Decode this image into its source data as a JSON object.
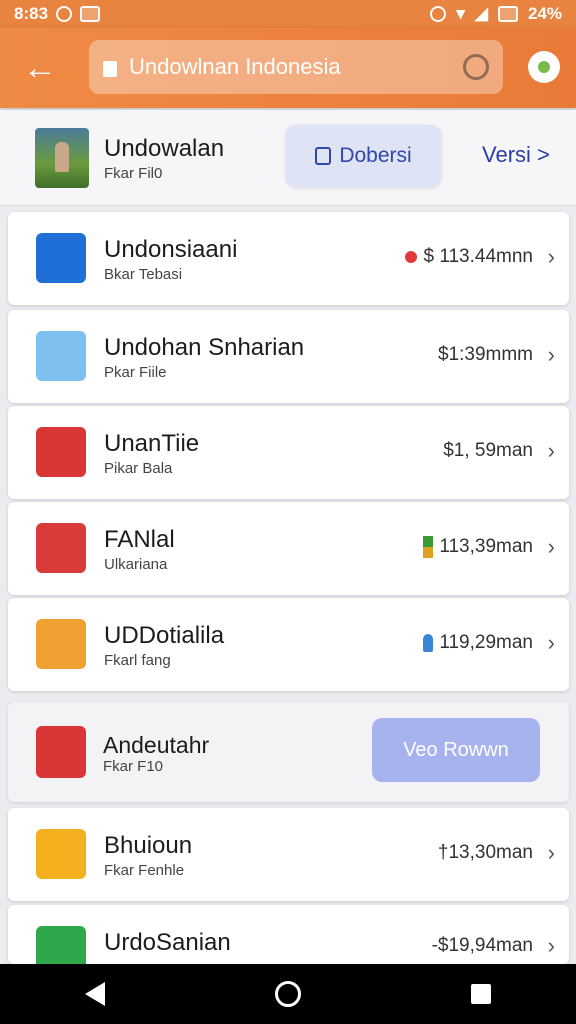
{
  "status_bar": {
    "time": "8:83",
    "battery": "24%"
  },
  "search": {
    "text": "Undowlnan Indonesia"
  },
  "featured": {
    "title": "Undowalan",
    "subtitle": "Fkar Fil0",
    "button_label": "Dobersi",
    "link_label": "Versi >"
  },
  "items": [
    {
      "name": "Undonsiaani",
      "sub": "Bkar Tebasi",
      "price": "$ 113.44mnn",
      "accent": "#e23a3a",
      "icon_color": "#1f6fd6",
      "icon_name": "app-icon-blue"
    },
    {
      "name": "Undohan Snharian",
      "sub": "Pkar Fiile",
      "price": "$1:39mmm",
      "accent": "",
      "icon_color": "#7ec0f0",
      "icon_name": "brush-icon"
    },
    {
      "name": "UnanTiie",
      "sub": "Pikar Bala",
      "price": "$1, 59man",
      "accent": "",
      "icon_color": "#d83535",
      "icon_name": "file-edit-icon"
    },
    {
      "name": "FANlal",
      "sub": "Ulkariana",
      "price": "113,39man",
      "accent": "bar",
      "icon_color": "#d93a3a",
      "icon_name": "document-icon"
    },
    {
      "name": "UDDotialila",
      "sub": "Fkarl fang",
      "price": "119,29man",
      "accent": "pin",
      "icon_color": "#f0a030",
      "icon_name": "folder-icon"
    }
  ],
  "featured2": {
    "name": "Andeutahr",
    "sub": "Fkar F10",
    "button_label": "Veo Rowwn"
  },
  "items2": [
    {
      "name": "Bhuioun",
      "sub": "Fkar Fenhle",
      "price": "†13,30man",
      "icon_color": "#f5b020",
      "icon_name": "play-icon"
    },
    {
      "name": "UrdoSanian",
      "sub": "",
      "price": "-$19,94man",
      "icon_color": "#2ea84a",
      "icon_name": "sheet-icon"
    }
  ]
}
